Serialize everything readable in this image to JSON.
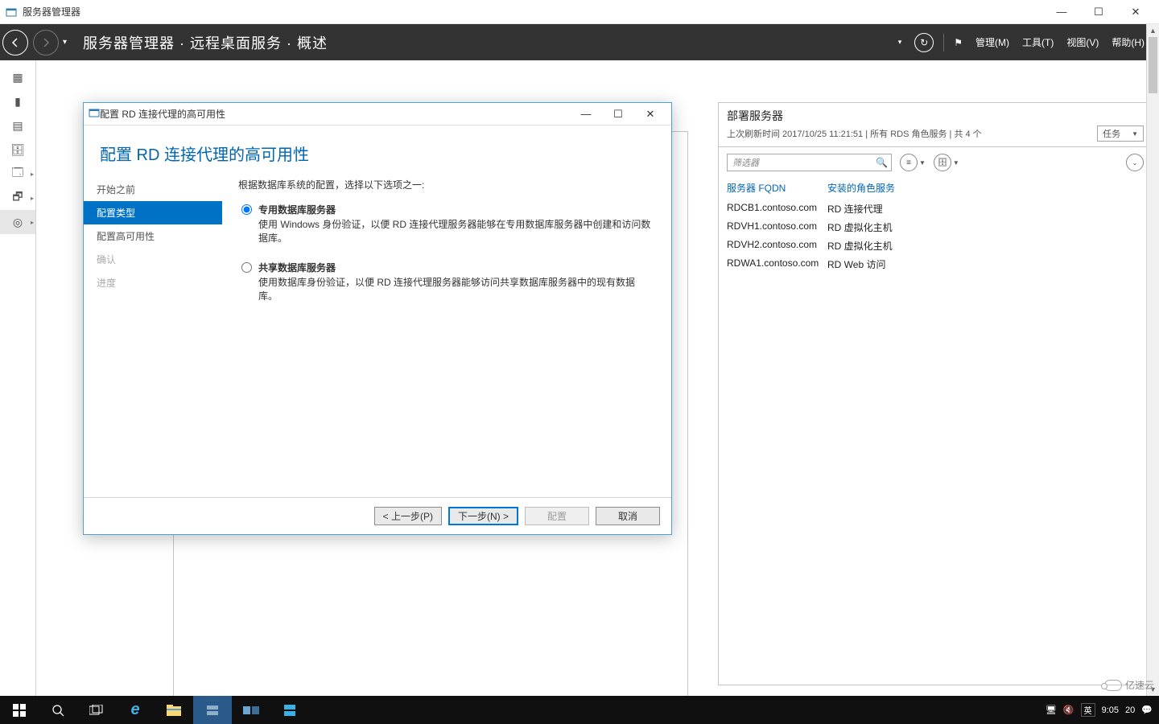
{
  "window": {
    "title": "服务器管理器",
    "min": "—",
    "max": "☐",
    "close": "✕"
  },
  "header": {
    "breadcrumb": "服务器管理器 · 远程桌面服务 · 概述",
    "menu_manage": "管理(M)",
    "menu_tools": "工具(T)",
    "menu_view": "视图(V)",
    "menu_help": "帮助(H)"
  },
  "rightPanel": {
    "title": "部署服务器",
    "subtitle": "上次刷新时间 2017/10/25 11:21:51 | 所有 RDS 角色服务 | 共 4 个",
    "tasks": "任务",
    "filter_placeholder": "筛选器",
    "col_server": "服务器 FQDN",
    "col_role": "安装的角色服务",
    "rows": [
      {
        "fqdn": "RDCB1.contoso.com",
        "role": "RD 连接代理"
      },
      {
        "fqdn": "RDVH1.contoso.com",
        "role": "RD 虚拟化主机"
      },
      {
        "fqdn": "RDVH2.contoso.com",
        "role": "RD 虚拟化主机"
      },
      {
        "fqdn": "RDWA1.contoso.com",
        "role": "RD Web 访问"
      }
    ]
  },
  "dialog": {
    "title": "配置 RD 连接代理的高可用性",
    "heading": "配置 RD 连接代理的高可用性",
    "nav": {
      "before": "开始之前",
      "type": "配置类型",
      "ha": "配置高可用性",
      "confirm": "确认",
      "progress": "进度"
    },
    "intro": "根据数据库系统的配置，选择以下选项之一:",
    "opt1": {
      "title": "专用数据库服务器",
      "desc": "使用 Windows 身份验证，以便 RD 连接代理服务器能够在专用数据库服务器中创建和访问数据库。"
    },
    "opt2": {
      "title": "共享数据库服务器",
      "desc": "使用数据库身份验证，以便 RD 连接代理服务器能够访问共享数据库服务器中的现有数据库。"
    },
    "btn_prev": "< 上一步(P)",
    "btn_next": "下一步(N) >",
    "btn_config": "配置",
    "btn_cancel": "取消"
  },
  "taskbar": {
    "time": "9:05",
    "date": "20",
    "ime": "英"
  },
  "watermark": "亿速云"
}
